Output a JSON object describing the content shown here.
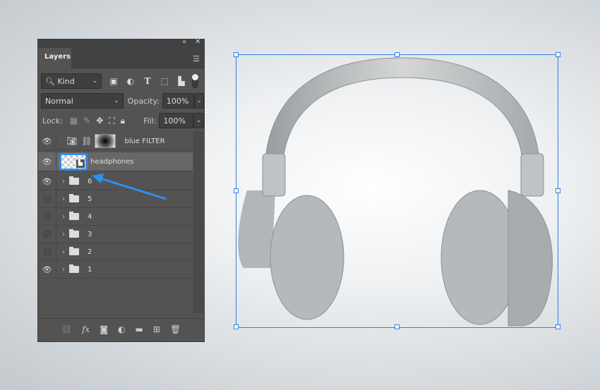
{
  "panel": {
    "collapse_icon": "double-chevron-left-icon",
    "close_icon": "close-icon",
    "tab": "Layers",
    "menu_icon": "hamburger-menu-icon"
  },
  "filter": {
    "kind_label": "Kind",
    "icons": [
      "image-filter-icon",
      "adjustment-filter-icon",
      "type-filter-icon",
      "shape-filter-icon",
      "smart-object-filter-icon"
    ]
  },
  "blend": {
    "mode": "Normal",
    "opacity_label": "Opacity:",
    "opacity": "100%"
  },
  "lock": {
    "label": "Lock:",
    "fill_label": "Fill:",
    "fill": "100%"
  },
  "layers": [
    {
      "name": "blue FILTER",
      "visible": true,
      "type": "adjustment"
    },
    {
      "name": "headphones",
      "visible": true,
      "type": "smart-object",
      "selected": true
    },
    {
      "name": "6",
      "visible": true,
      "type": "group"
    },
    {
      "name": "5",
      "visible": false,
      "type": "group"
    },
    {
      "name": "4",
      "visible": false,
      "type": "group"
    },
    {
      "name": "3",
      "visible": false,
      "type": "group"
    },
    {
      "name": "2",
      "visible": false,
      "type": "group"
    },
    {
      "name": "1",
      "visible": true,
      "type": "group"
    }
  ],
  "bottom_icons": [
    "link-icon",
    "fx-icon",
    "mask-icon",
    "adjustment-icon",
    "folder-icon",
    "new-layer-icon",
    "trash-icon"
  ],
  "colors": {
    "accent": "#2f8ff0",
    "panel": "#535353",
    "selected": "#6a6a6a"
  }
}
